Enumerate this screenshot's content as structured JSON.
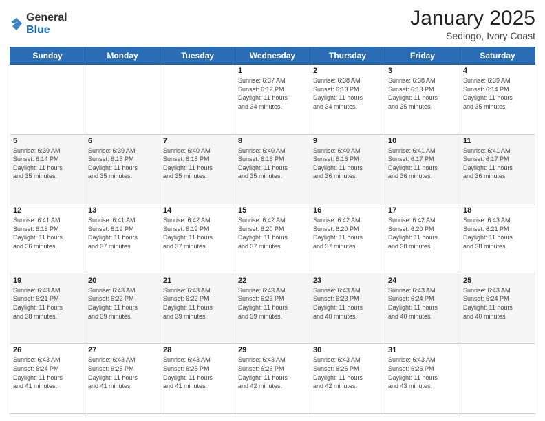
{
  "header": {
    "logo_general": "General",
    "logo_blue": "Blue",
    "title": "January 2025",
    "location": "Sediogo, Ivory Coast"
  },
  "days_of_week": [
    "Sunday",
    "Monday",
    "Tuesday",
    "Wednesday",
    "Thursday",
    "Friday",
    "Saturday"
  ],
  "weeks": [
    [
      {
        "day": "",
        "info": ""
      },
      {
        "day": "",
        "info": ""
      },
      {
        "day": "",
        "info": ""
      },
      {
        "day": "1",
        "info": "Sunrise: 6:37 AM\nSunset: 6:12 PM\nDaylight: 11 hours\nand 34 minutes."
      },
      {
        "day": "2",
        "info": "Sunrise: 6:38 AM\nSunset: 6:13 PM\nDaylight: 11 hours\nand 34 minutes."
      },
      {
        "day": "3",
        "info": "Sunrise: 6:38 AM\nSunset: 6:13 PM\nDaylight: 11 hours\nand 35 minutes."
      },
      {
        "day": "4",
        "info": "Sunrise: 6:39 AM\nSunset: 6:14 PM\nDaylight: 11 hours\nand 35 minutes."
      }
    ],
    [
      {
        "day": "5",
        "info": "Sunrise: 6:39 AM\nSunset: 6:14 PM\nDaylight: 11 hours\nand 35 minutes."
      },
      {
        "day": "6",
        "info": "Sunrise: 6:39 AM\nSunset: 6:15 PM\nDaylight: 11 hours\nand 35 minutes."
      },
      {
        "day": "7",
        "info": "Sunrise: 6:40 AM\nSunset: 6:15 PM\nDaylight: 11 hours\nand 35 minutes."
      },
      {
        "day": "8",
        "info": "Sunrise: 6:40 AM\nSunset: 6:16 PM\nDaylight: 11 hours\nand 35 minutes."
      },
      {
        "day": "9",
        "info": "Sunrise: 6:40 AM\nSunset: 6:16 PM\nDaylight: 11 hours\nand 36 minutes."
      },
      {
        "day": "10",
        "info": "Sunrise: 6:41 AM\nSunset: 6:17 PM\nDaylight: 11 hours\nand 36 minutes."
      },
      {
        "day": "11",
        "info": "Sunrise: 6:41 AM\nSunset: 6:17 PM\nDaylight: 11 hours\nand 36 minutes."
      }
    ],
    [
      {
        "day": "12",
        "info": "Sunrise: 6:41 AM\nSunset: 6:18 PM\nDaylight: 11 hours\nand 36 minutes."
      },
      {
        "day": "13",
        "info": "Sunrise: 6:41 AM\nSunset: 6:19 PM\nDaylight: 11 hours\nand 37 minutes."
      },
      {
        "day": "14",
        "info": "Sunrise: 6:42 AM\nSunset: 6:19 PM\nDaylight: 11 hours\nand 37 minutes."
      },
      {
        "day": "15",
        "info": "Sunrise: 6:42 AM\nSunset: 6:20 PM\nDaylight: 11 hours\nand 37 minutes."
      },
      {
        "day": "16",
        "info": "Sunrise: 6:42 AM\nSunset: 6:20 PM\nDaylight: 11 hours\nand 37 minutes."
      },
      {
        "day": "17",
        "info": "Sunrise: 6:42 AM\nSunset: 6:20 PM\nDaylight: 11 hours\nand 38 minutes."
      },
      {
        "day": "18",
        "info": "Sunrise: 6:43 AM\nSunset: 6:21 PM\nDaylight: 11 hours\nand 38 minutes."
      }
    ],
    [
      {
        "day": "19",
        "info": "Sunrise: 6:43 AM\nSunset: 6:21 PM\nDaylight: 11 hours\nand 38 minutes."
      },
      {
        "day": "20",
        "info": "Sunrise: 6:43 AM\nSunset: 6:22 PM\nDaylight: 11 hours\nand 39 minutes."
      },
      {
        "day": "21",
        "info": "Sunrise: 6:43 AM\nSunset: 6:22 PM\nDaylight: 11 hours\nand 39 minutes."
      },
      {
        "day": "22",
        "info": "Sunrise: 6:43 AM\nSunset: 6:23 PM\nDaylight: 11 hours\nand 39 minutes."
      },
      {
        "day": "23",
        "info": "Sunrise: 6:43 AM\nSunset: 6:23 PM\nDaylight: 11 hours\nand 40 minutes."
      },
      {
        "day": "24",
        "info": "Sunrise: 6:43 AM\nSunset: 6:24 PM\nDaylight: 11 hours\nand 40 minutes."
      },
      {
        "day": "25",
        "info": "Sunrise: 6:43 AM\nSunset: 6:24 PM\nDaylight: 11 hours\nand 40 minutes."
      }
    ],
    [
      {
        "day": "26",
        "info": "Sunrise: 6:43 AM\nSunset: 6:24 PM\nDaylight: 11 hours\nand 41 minutes."
      },
      {
        "day": "27",
        "info": "Sunrise: 6:43 AM\nSunset: 6:25 PM\nDaylight: 11 hours\nand 41 minutes."
      },
      {
        "day": "28",
        "info": "Sunrise: 6:43 AM\nSunset: 6:25 PM\nDaylight: 11 hours\nand 41 minutes."
      },
      {
        "day": "29",
        "info": "Sunrise: 6:43 AM\nSunset: 6:26 PM\nDaylight: 11 hours\nand 42 minutes."
      },
      {
        "day": "30",
        "info": "Sunrise: 6:43 AM\nSunset: 6:26 PM\nDaylight: 11 hours\nand 42 minutes."
      },
      {
        "day": "31",
        "info": "Sunrise: 6:43 AM\nSunset: 6:26 PM\nDaylight: 11 hours\nand 43 minutes."
      },
      {
        "day": "",
        "info": ""
      }
    ]
  ]
}
